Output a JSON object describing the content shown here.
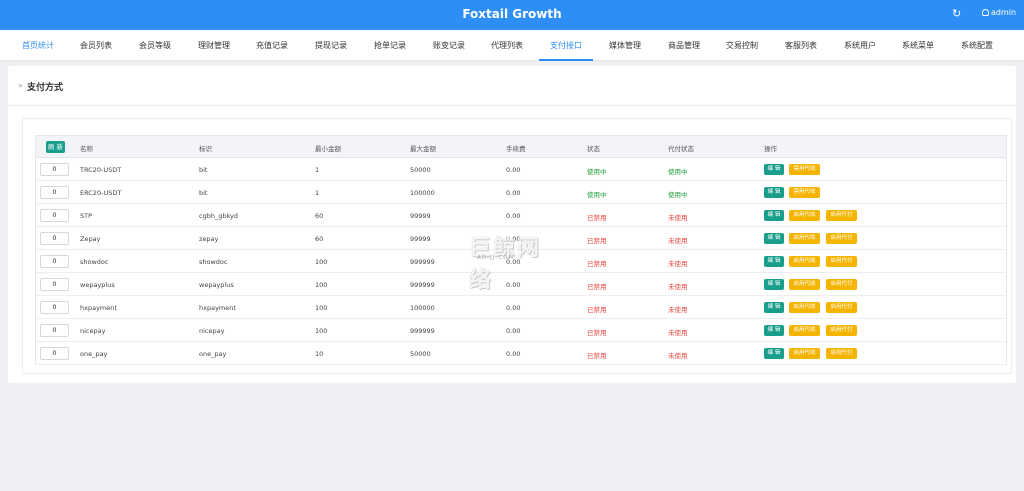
{
  "header": {
    "title": "Foxtail Growth",
    "refresh_icon": "refresh-icon",
    "user_icon": "user-icon",
    "username": "admin"
  },
  "nav": {
    "tabs": [
      {
        "label": "首页统计"
      },
      {
        "label": "会员列表"
      },
      {
        "label": "会员等级"
      },
      {
        "label": "理财管理"
      },
      {
        "label": "充值记录"
      },
      {
        "label": "提现记录"
      },
      {
        "label": "抢单记录"
      },
      {
        "label": "账变记录"
      },
      {
        "label": "代理列表"
      },
      {
        "label": "支付接口"
      },
      {
        "label": "媒体管理"
      },
      {
        "label": "商品管理"
      },
      {
        "label": "交易控制"
      },
      {
        "label": "客服列表"
      },
      {
        "label": "系统用户"
      },
      {
        "label": "系统菜单"
      },
      {
        "label": "系统配置"
      }
    ],
    "active_index": 9,
    "accent": "#2d8ff5"
  },
  "page": {
    "breadcrumb_marker": "»",
    "title": "支付方式"
  },
  "table": {
    "refresh_label": "刷 新",
    "columns": [
      "名称",
      "标识",
      "最小金额",
      "最大金额",
      "手续费",
      "状态",
      "代付状态",
      "操作"
    ],
    "edit_label": "编 辑",
    "rows": [
      {
        "sort": "0",
        "name": "TRC20-USDT",
        "code": "bit",
        "min": "1",
        "max": "50000",
        "fee": "0.00",
        "status": "使用中",
        "payout": "使用中",
        "actions": [
          "禁用代收"
        ]
      },
      {
        "sort": "0",
        "name": "ERC20-USDT",
        "code": "bit",
        "min": "1",
        "max": "100000",
        "fee": "0.00",
        "status": "使用中",
        "payout": "使用中",
        "actions": [
          "禁用代收"
        ]
      },
      {
        "sort": "0",
        "name": "STP",
        "code": "cgbh_gbkyd",
        "min": "60",
        "max": "99999",
        "fee": "0.00",
        "status": "已禁用",
        "payout": "未使用",
        "actions": [
          "启用代收",
          "启用代付"
        ]
      },
      {
        "sort": "0",
        "name": "Zepay",
        "code": "zepay",
        "min": "60",
        "max": "99999",
        "fee": "0.00",
        "status": "已禁用",
        "payout": "未使用",
        "actions": [
          "启用代收",
          "启用代付"
        ]
      },
      {
        "sort": "0",
        "name": "showdoc",
        "code": "showdoc",
        "min": "100",
        "max": "999999",
        "fee": "0.00",
        "status": "已禁用",
        "payout": "未使用",
        "actions": [
          "启用代收",
          "启用代付"
        ]
      },
      {
        "sort": "0",
        "name": "wepayplus",
        "code": "wepayplus",
        "min": "100",
        "max": "999999",
        "fee": "0.00",
        "status": "已禁用",
        "payout": "未使用",
        "actions": [
          "启用代收",
          "启用代付"
        ]
      },
      {
        "sort": "0",
        "name": "hxpayment",
        "code": "hxpayment",
        "min": "100",
        "max": "100000",
        "fee": "0.00",
        "status": "已禁用",
        "payout": "未使用",
        "actions": [
          "启用代收",
          "启用代付"
        ]
      },
      {
        "sort": "0",
        "name": "nicepay",
        "code": "nicepay",
        "min": "100",
        "max": "999999",
        "fee": "0.00",
        "status": "已禁用",
        "payout": "未使用",
        "actions": [
          "启用代收",
          "启用代付"
        ]
      },
      {
        "sort": "0",
        "name": "one_pay",
        "code": "one_pay",
        "min": "10",
        "max": "50000",
        "fee": "0.00",
        "status": "已禁用",
        "payout": "未使用",
        "actions": [
          "启用代收",
          "启用代付"
        ]
      }
    ],
    "colors": {
      "active": "#1f9e3b",
      "disabled": "#e8453c",
      "edit": "#1a9e8c",
      "toggle": "#f5b400"
    }
  },
  "watermark": {
    "main": "巨鲸网络",
    "sub": "AD-JJ.COM"
  }
}
